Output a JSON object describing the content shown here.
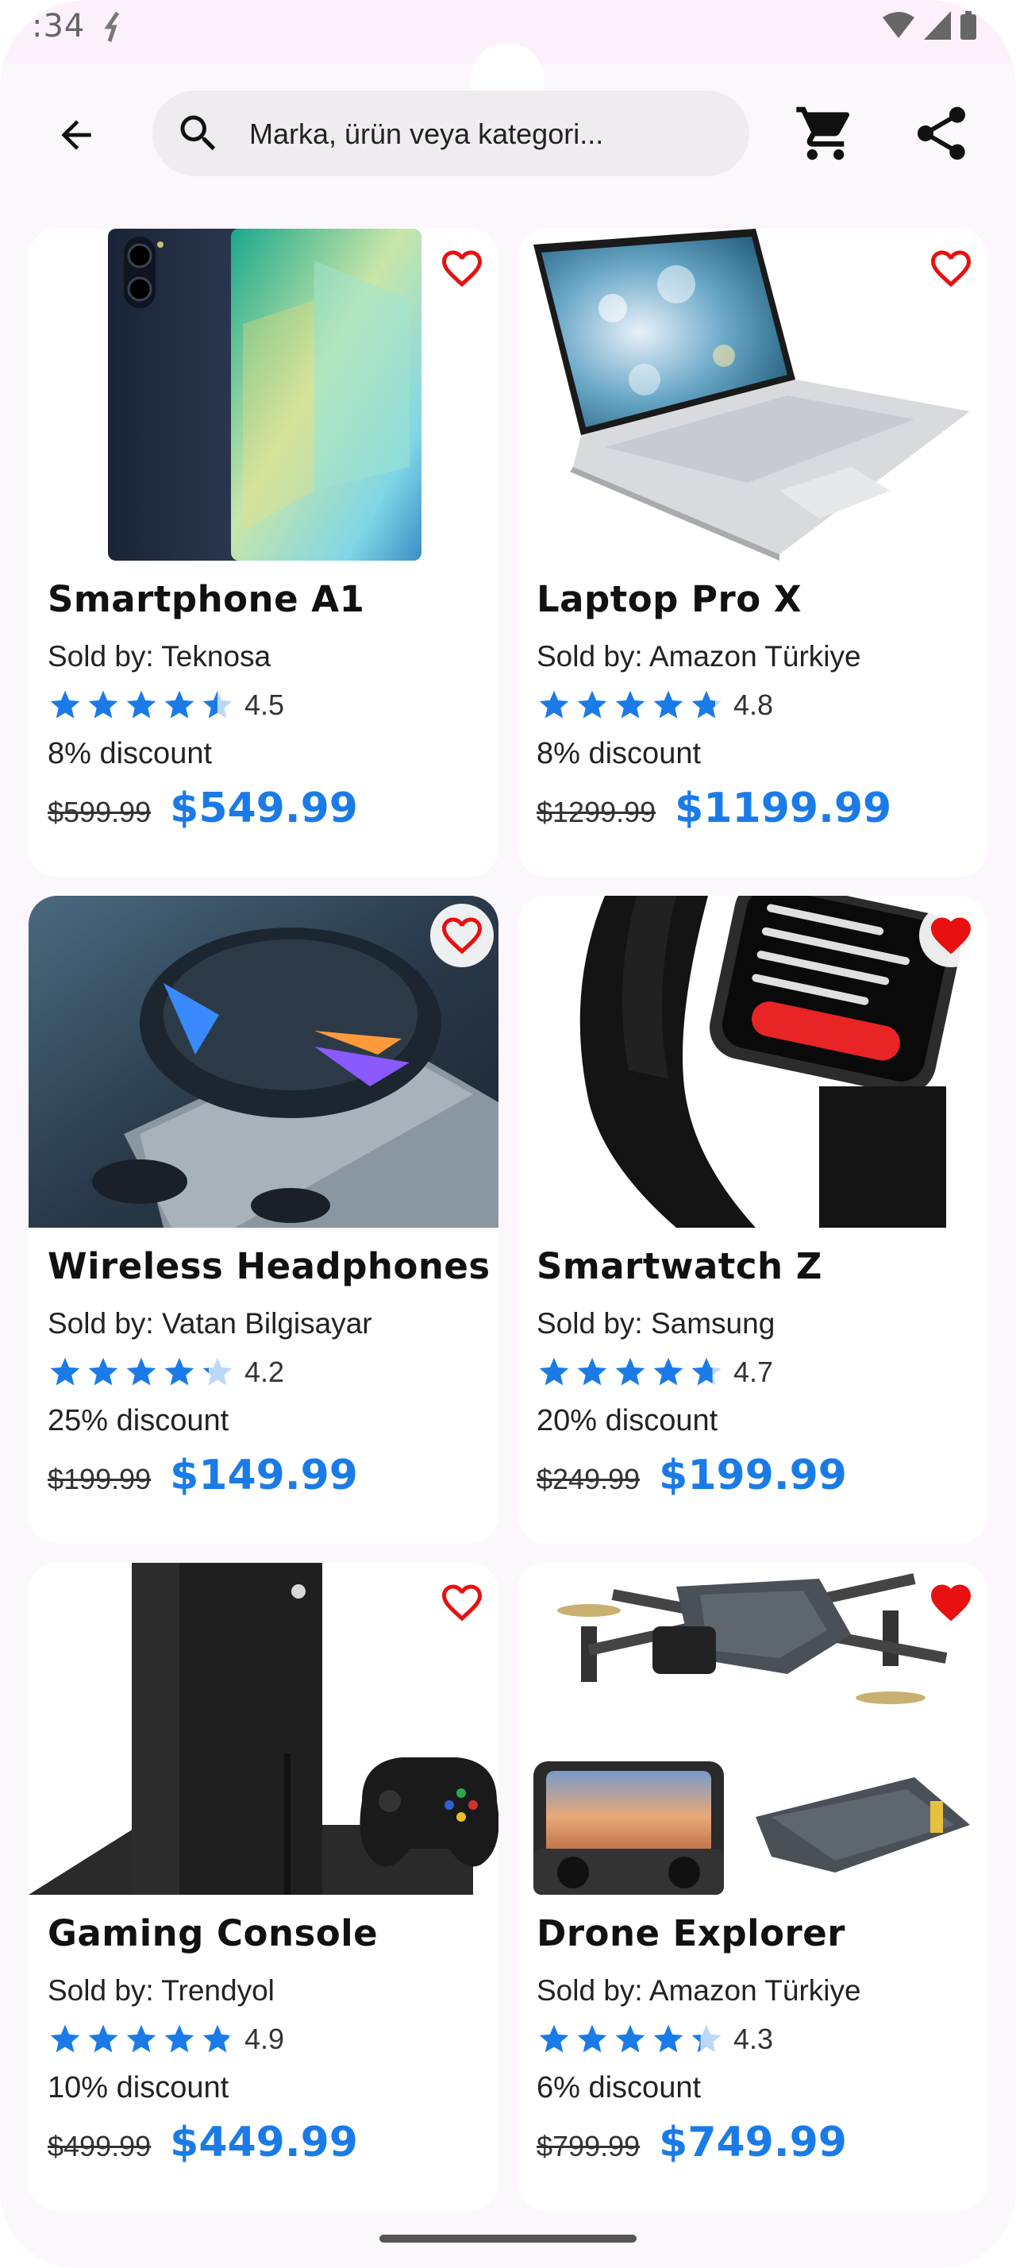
{
  "status_bar": {
    "time": ":34"
  },
  "search": {
    "placeholder": "Marka, ürün veya kategori..."
  },
  "colors": {
    "accent": "#1a7be8",
    "favorite": "#e81010",
    "star": "#1a7be8",
    "star_empty": "#bcd8f8"
  },
  "products": [
    {
      "title": "Smartphone A1",
      "seller": "Sold by: Teknosa",
      "rating": "4.5",
      "rating_value": 4.5,
      "discount": "8% discount",
      "old_price": "$599.99",
      "price": "$549.99",
      "favorite": false
    },
    {
      "title": "Laptop Pro X",
      "seller": "Sold by: Amazon Türkiye",
      "rating": "4.8",
      "rating_value": 4.8,
      "discount": "8% discount",
      "old_price": "$1299.99",
      "price": "$1199.99",
      "favorite": false
    },
    {
      "title": "Wireless Headphones",
      "seller": "Sold by: Vatan Bilgisayar",
      "rating": "4.2",
      "rating_value": 4.2,
      "discount": "25% discount",
      "old_price": "$199.99",
      "price": "$149.99",
      "favorite": false
    },
    {
      "title": "Smartwatch Z",
      "seller": "Sold by: Samsung",
      "rating": "4.7",
      "rating_value": 4.7,
      "discount": "20% discount",
      "old_price": "$249.99",
      "price": "$199.99",
      "favorite": true
    },
    {
      "title": "Gaming Console",
      "seller": "Sold by: Trendyol",
      "rating": "4.9",
      "rating_value": 4.9,
      "discount": "10% discount",
      "old_price": "$499.99",
      "price": "$449.99",
      "favorite": false
    },
    {
      "title": "Drone Explorer",
      "seller": "Sold by: Amazon Türkiye",
      "rating": "4.3",
      "rating_value": 4.3,
      "discount": "6% discount",
      "old_price": "$799.99",
      "price": "$749.99",
      "favorite": true
    }
  ]
}
